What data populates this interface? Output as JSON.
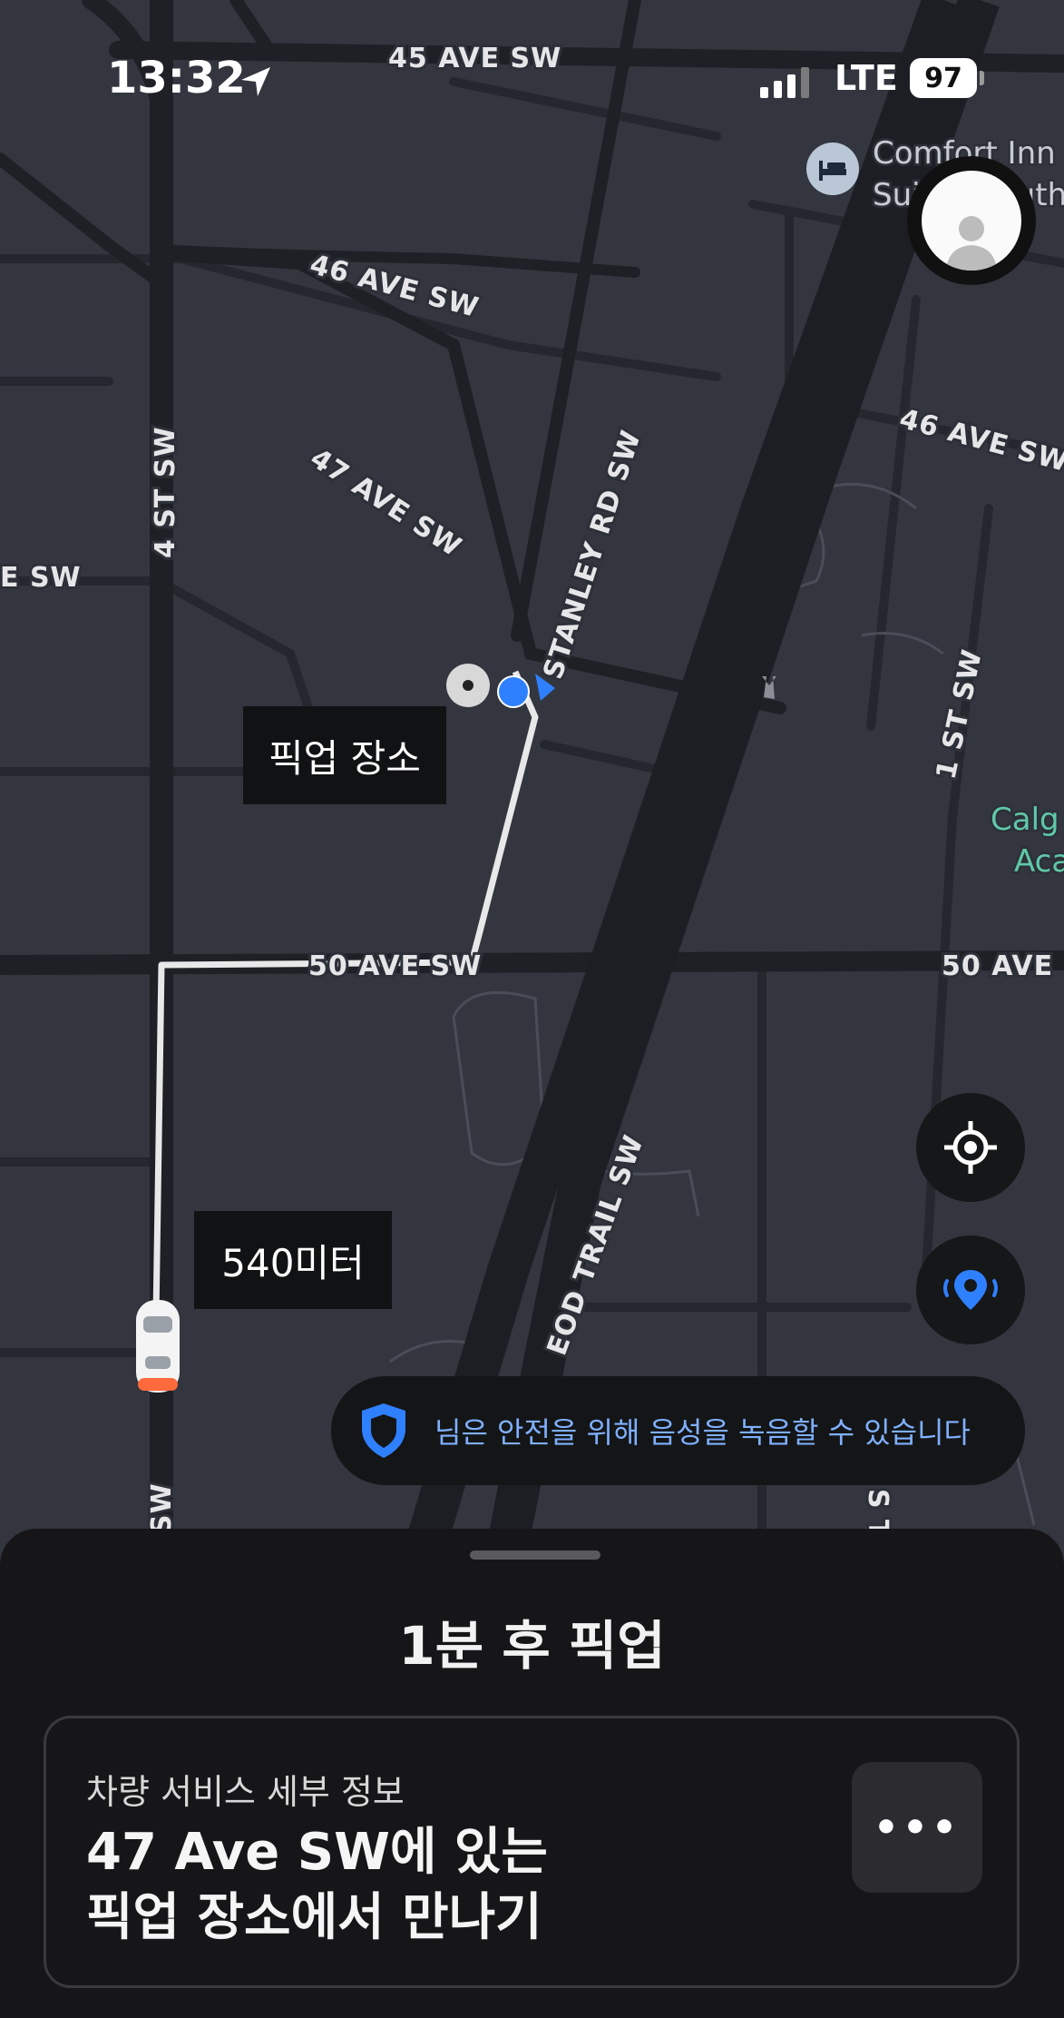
{
  "status_bar": {
    "time": "13:32",
    "network": "LTE",
    "battery": "97"
  },
  "map": {
    "streets": {
      "ave45": "45 AVE SW",
      "ave46_left": "46 AVE SW",
      "ave46_right": "46 AVE SW",
      "ave47": "47 AVE SW",
      "st4": "4 ST SW",
      "stanley": "STANLEY RD SW",
      "ave_sw_left": "E SW",
      "ave50_left": "50 AVE SW",
      "ave50_right": "50 AVE",
      "st1": "1 ST SW",
      "macleod": "EOD TRAIL SW",
      "sw_bottom": "SW",
      "st_bottom": "S T"
    },
    "poi": {
      "hotel_line1": "Comfort Inn",
      "hotel_line2": "Suites South",
      "academy_line1": "Calg",
      "academy_line2": "Aca"
    },
    "pickup_label": "픽업 장소",
    "distance_label": "540미터",
    "safety_message": "님은 안전을 위해 음성을 녹음할 수 있습니다",
    "route_color": "#e8e8e8",
    "accent_blue": "#2f80ff"
  },
  "sheet": {
    "title": "1분 후 픽업",
    "card_subtitle": "차량 서비스 세부 정보",
    "card_title": "47 Ave SW에 있는 픽업 장소에서 만나기",
    "more_label": "•••"
  },
  "icons": [
    "navigation-arrow-icon",
    "signal-icon",
    "battery-icon",
    "hotel-icon",
    "avatar-icon",
    "recenter-icon",
    "share-location-icon",
    "shield-icon",
    "car-icon",
    "pickup-pin-icon"
  ]
}
